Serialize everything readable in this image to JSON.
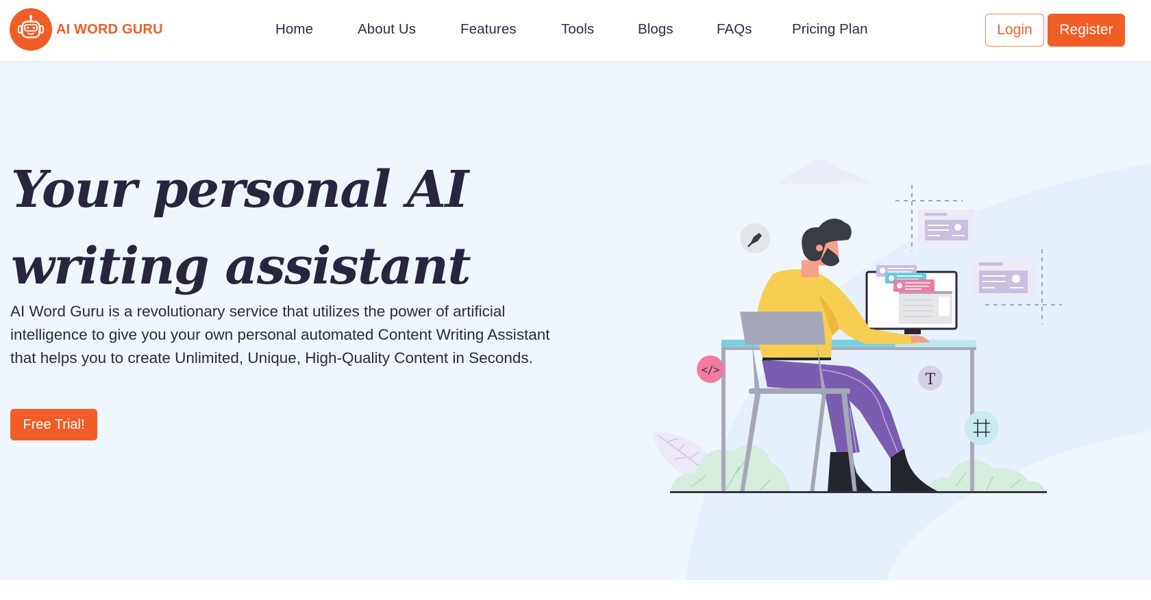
{
  "brand": {
    "name": "AI WORD GURU",
    "logo_icon": "robot-icon",
    "accent_color": "#f15d27"
  },
  "nav": {
    "items": [
      {
        "label": "Home"
      },
      {
        "label": "About Us"
      },
      {
        "label": "Features"
      },
      {
        "label": "Tools"
      },
      {
        "label": "Blogs"
      },
      {
        "label": "FAQs"
      },
      {
        "label": "Pricing Plan"
      }
    ],
    "login_label": "Login",
    "register_label": "Register"
  },
  "hero": {
    "title_line1": "Your personal AI",
    "title_line2": "writing assistant",
    "description": "AI Word Guru is a revolutionary service that utilizes the power of artificial intelligence to give you your own personal automated Content Writing Assistant that helps you to create Unlimited, Unique, High-Quality Content in Seconds.",
    "cta_label": "Free Trial!"
  },
  "illustration": {
    "subject": "person-at-desk-computer",
    "floating_icons": [
      "pen-tool-icon",
      "code-icon",
      "text-type-icon",
      "grid-icon"
    ],
    "text_glyphs": {
      "code": "</>",
      "type": "T"
    }
  }
}
